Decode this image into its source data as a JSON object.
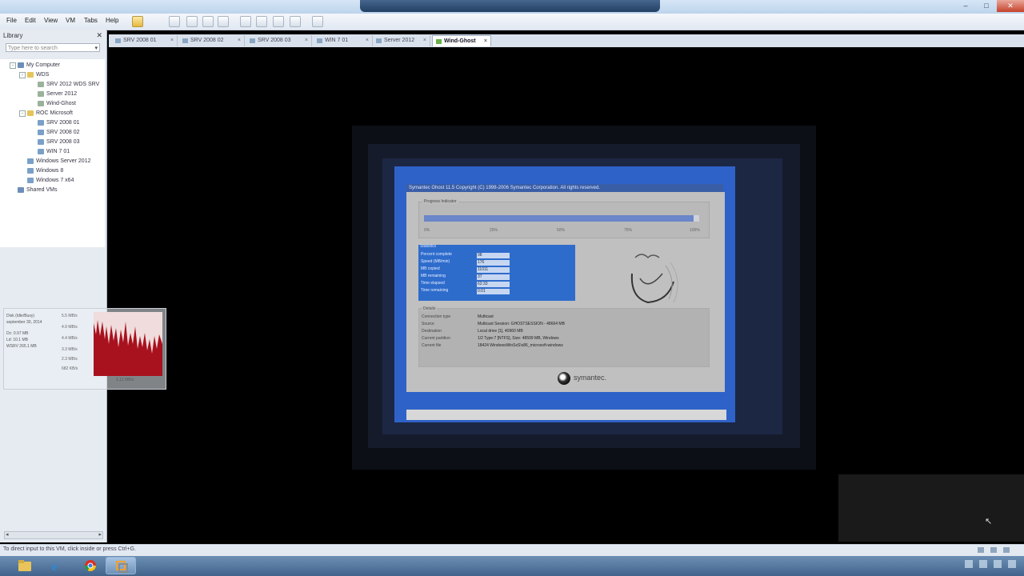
{
  "window": {
    "title": ""
  },
  "menu": [
    "File",
    "Edit",
    "View",
    "VM",
    "Tabs",
    "Help"
  ],
  "library": {
    "title": "Library",
    "search_placeholder": "Type here to search",
    "tree": [
      {
        "label": "My Computer",
        "level": 0,
        "icon": "computer-icon"
      },
      {
        "label": "WDS",
        "level": 1,
        "icon": "folder-icon"
      },
      {
        "label": "SRV 2012 WDS SRV",
        "level": 2,
        "icon": "vm-icon"
      },
      {
        "label": "Server 2012",
        "level": 2,
        "icon": "vm-icon"
      },
      {
        "label": "Wind-Ghost",
        "level": 2,
        "icon": "vm-icon"
      },
      {
        "label": "ROC Microsoft",
        "level": 1,
        "icon": "folder-icon"
      },
      {
        "label": "SRV 2008 01",
        "level": 2,
        "icon": "vm-icon"
      },
      {
        "label": "SRV 2008 02",
        "level": 2,
        "icon": "vm-icon"
      },
      {
        "label": "SRV 2008 03",
        "level": 2,
        "icon": "vm-icon"
      },
      {
        "label": "WIN 7 01",
        "level": 2,
        "icon": "vm-icon"
      },
      {
        "label": "Windows Server 2012",
        "level": 1,
        "icon": "vm-icon"
      },
      {
        "label": "Windows 8",
        "level": 1,
        "icon": "vm-icon"
      },
      {
        "label": "Windows 7 x64",
        "level": 1,
        "icon": "vm-icon"
      },
      {
        "label": "Shared VMs",
        "level": 0,
        "icon": "shared-vm-icon"
      }
    ]
  },
  "tabs": [
    {
      "label": "SRV 2008 01",
      "active": false
    },
    {
      "label": "SRV 2008 02",
      "active": false
    },
    {
      "label": "SRV 2008 03",
      "active": false
    },
    {
      "label": "WIN 7 01",
      "active": false
    },
    {
      "label": "Server 2012",
      "active": false
    },
    {
      "label": "Wind-Ghost",
      "active": true
    }
  ],
  "ghost": {
    "title": "Symantec Ghost 11.5 Copyright (C) 1998-2006 Symantec Corporation. All rights reserved.",
    "progress_label": "Progress Indicator",
    "progress_fraction": 0.98,
    "progress_ticks": [
      "0%",
      "25%",
      "50%",
      "75%",
      "100%"
    ],
    "stats_label": "Statistics",
    "stats": [
      {
        "label": "Percent complete",
        "value": "98"
      },
      {
        "label": "Speed (MB/min)",
        "value": "176"
      },
      {
        "label": "MB copied",
        "value": "11011"
      },
      {
        "label": "MB remaining",
        "value": "37"
      },
      {
        "label": "Time elapsed",
        "value": "62:33"
      },
      {
        "label": "Time remaining",
        "value": "0:01"
      }
    ],
    "details_label": "Details",
    "details": [
      {
        "label": "Connection type",
        "value": "Multicast"
      },
      {
        "label": "Source",
        "value": "Multicast Session: GHOSTSESSION - 48664 MB"
      },
      {
        "label": "Destination",
        "value": "Local drive [1], 40960 MB"
      },
      {
        "label": "Current partition",
        "value": "1/2 Type:7 [NTFS], Size: 48599 MB, Windows"
      },
      {
        "label": "Current file",
        "value": "18424 WindowsWinSxS\\x86_microsoft-windows"
      }
    ],
    "brand": "symantec."
  },
  "perf": {
    "lines": [
      "Disk (Idle/Busy)",
      "september 30, 2014",
      "Dc: 0.97 MB",
      "Ld: 10.1 MB",
      "WSRV 265.1 MB"
    ],
    "scale": [
      "5.5 MB/s",
      "4.9 MB/s",
      "4.4 MB/s",
      "3.3 MB/s",
      "2.3 MB/s",
      "682 KB/s"
    ],
    "footer": "1.12 MB/s"
  },
  "status": {
    "message": "To direct input to this VM, click inside or press Ctrl+G."
  },
  "taskbar": [
    {
      "name": "file-explorer-icon",
      "active": false
    },
    {
      "name": "internet-explorer-icon",
      "active": false
    },
    {
      "name": "chrome-icon",
      "active": false
    },
    {
      "name": "vmware-icon",
      "active": true
    }
  ],
  "colors": {
    "accent": "#2f62c8",
    "progress": "#6b86c9",
    "graph": "#a8121f"
  }
}
